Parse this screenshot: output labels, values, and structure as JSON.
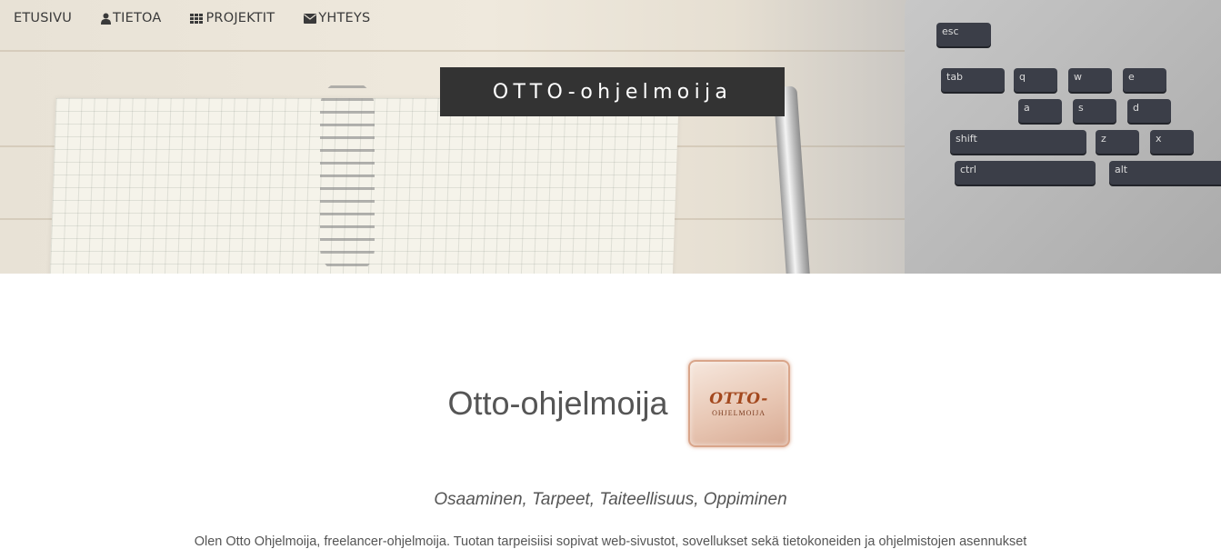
{
  "nav": {
    "items": [
      {
        "label": "ETUSIVU",
        "icon": ""
      },
      {
        "label": "TIETOA",
        "icon": "user-icon"
      },
      {
        "label": "PROJEKTIT",
        "icon": "grid-icon"
      },
      {
        "label": "YHTEYS",
        "icon": "envelope-icon"
      }
    ]
  },
  "hero": {
    "brand": "OTTO-ohjelmoija",
    "keys": [
      "esc",
      "tab",
      "q",
      "w",
      "e",
      "a",
      "s",
      "d",
      "shift",
      "z",
      "x",
      "ctrl",
      "alt"
    ]
  },
  "main": {
    "title": "Otto-ohjelmoija",
    "logo": {
      "main": "OTTO-",
      "sub": "OHJELMOIJA"
    },
    "tagline": "Osaaminen, Tarpeet, Taiteellisuus, Oppiminen",
    "intro": "Olen Otto Ohjelmoija, freelancer-ohjelmoija. Tuotan tarpeisiisi sopivat web-sivustot, sovellukset sekä tietokoneiden ja ohjelmistojen asennukset"
  },
  "colors": {
    "brand_box_bg": "#333333",
    "brand_text": "#ffffff",
    "logo_text": "#a3481e",
    "body_text": "#555555"
  }
}
